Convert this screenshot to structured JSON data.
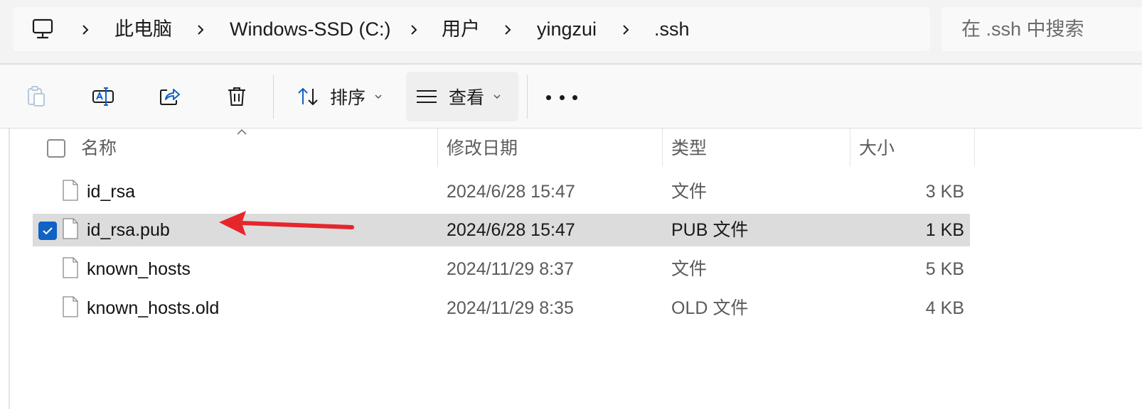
{
  "breadcrumb": [
    "此电脑",
    "Windows-SSD (C:)",
    "用户",
    "yingzui",
    ".ssh"
  ],
  "search": {
    "placeholder": "在 .ssh 中搜索"
  },
  "toolbar": {
    "sort_label": "排序",
    "view_label": "查看"
  },
  "columns": {
    "name": "名称",
    "modified": "修改日期",
    "type": "类型",
    "size": "大小"
  },
  "files": [
    {
      "name": "id_rsa",
      "modified": "2024/6/28 15:47",
      "type": "文件",
      "size": "3 KB",
      "selected": false
    },
    {
      "name": "id_rsa.pub",
      "modified": "2024/6/28 15:47",
      "type": "PUB 文件",
      "size": "1 KB",
      "selected": true
    },
    {
      "name": "known_hosts",
      "modified": "2024/11/29 8:37",
      "type": "文件",
      "size": "5 KB",
      "selected": false
    },
    {
      "name": "known_hosts.old",
      "modified": "2024/11/29 8:35",
      "type": "OLD 文件",
      "size": "4 KB",
      "selected": false
    }
  ],
  "colors": {
    "accent": "#1062c4",
    "annotation_arrow": "#e5262b",
    "selected_row": "#dcdcdc"
  },
  "icons": [
    "computer-icon",
    "chevron-right-icon",
    "paste-icon",
    "rename-icon",
    "share-icon",
    "delete-icon",
    "sort-icon",
    "view-icon",
    "more-icon",
    "file-icon",
    "annotation-arrow"
  ]
}
